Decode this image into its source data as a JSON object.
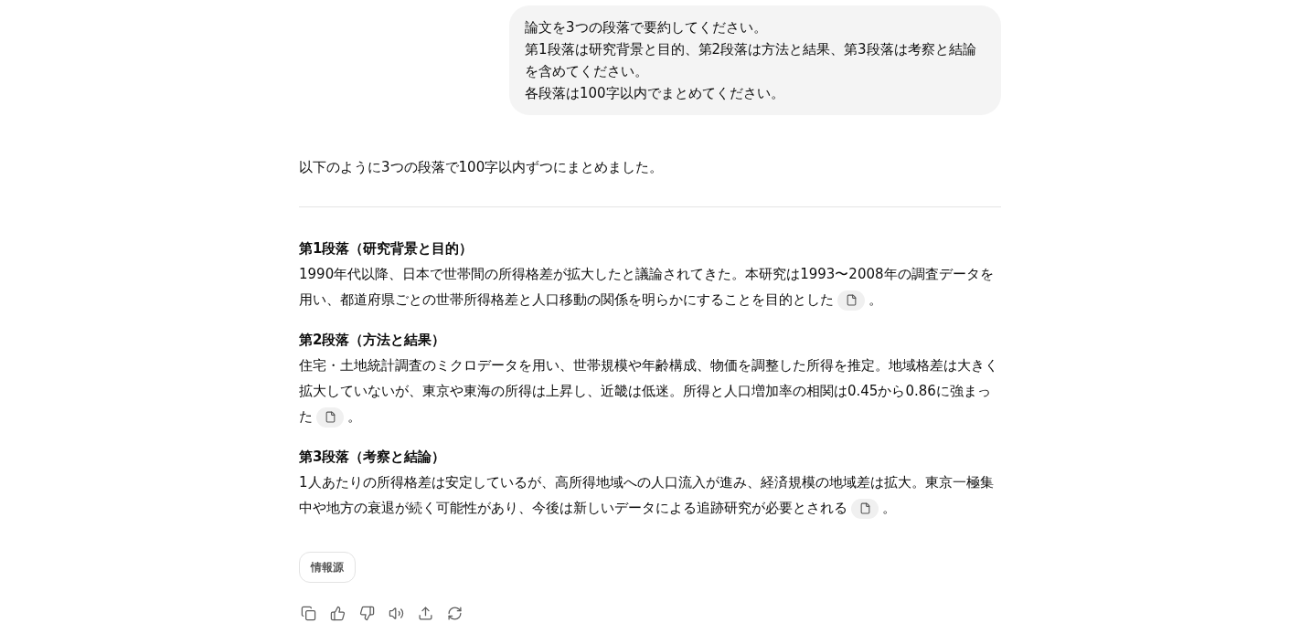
{
  "user_message": {
    "lines": [
      "論文を3つの段落で要約してください。",
      "第1段落は研究背景と目的、第2段落は方法と結果、第3段落は考察と結論を含めてください。",
      "各段落は100字以内でまとめてください。"
    ]
  },
  "response": {
    "intro": "以下のように3つの段落で100字以内ずつにまとめました。",
    "sections": [
      {
        "heading": "第1段落（研究背景と目的）",
        "text": "1990年代以降、日本で世帯間の所得格差が拡大したと議論されてきた。本研究は1993〜2008年の調査データを用い、都道府県ごとの世帯所得格差と人口移動の関係を明らかにすることを目的とした",
        "end": "。"
      },
      {
        "heading": "第2段落（方法と結果）",
        "text": "住宅・土地統計調査のミクロデータを用い、世帯規模や年齢構成、物価を調整した所得を推定。地域格差は大きく拡大していないが、東京や東海の所得は上昇し、近畿は低迷。所得と人口増加率の相関は0.45から0.86に強まった",
        "end": "。"
      },
      {
        "heading": "第3段落（考察と結論）",
        "text": "1人あたりの所得格差は安定しているが、高所得地域への人口流入が進み、経済規模の地域差は拡大。東京一極集中や地方の衰退が続く可能性があり、今後は新しいデータによる追跡研究が必要とされる",
        "end": "。"
      }
    ],
    "sources_button": "情報源",
    "actions": [
      {
        "kind": "copy"
      },
      {
        "kind": "like"
      },
      {
        "kind": "dislike"
      },
      {
        "kind": "read_aloud"
      },
      {
        "kind": "share"
      },
      {
        "kind": "regenerate"
      }
    ]
  }
}
